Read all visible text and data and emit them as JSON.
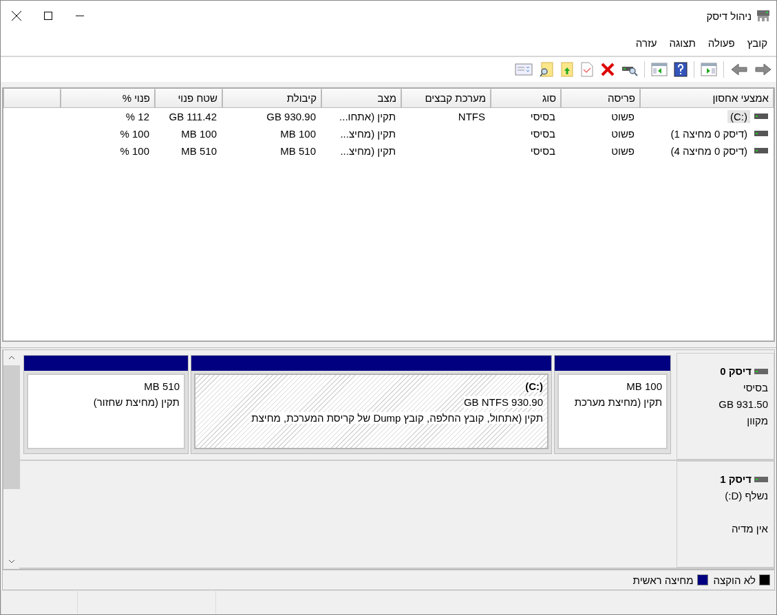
{
  "window": {
    "title": "ניהול דיסק"
  },
  "menu": [
    "קובץ",
    "פעולה",
    "תצוגה",
    "עזרה"
  ],
  "table": {
    "columns": [
      "אמצעי אחסון",
      "פריסה",
      "סוג",
      "מערכת קבצים",
      "מצב",
      "קיבולת",
      "שטח פנוי",
      "פנוי %"
    ],
    "rows": [
      {
        "selected": true,
        "cells": [
          "(C:)",
          "פשוט",
          "בסיסי",
          "NTFS",
          "תקין (אתחו...",
          "930.90 GB",
          "111.42 GB",
          "12 %"
        ]
      },
      {
        "selected": false,
        "cells": [
          "(דיסק 0 מחיצה 1)",
          "פשוט",
          "בסיסי",
          "",
          "תקין (מחיצ...",
          "100 MB",
          "100 MB",
          "100 %"
        ]
      },
      {
        "selected": false,
        "cells": [
          "(דיסק 0 מחיצה 4)",
          "פשוט",
          "בסיסי",
          "",
          "תקין (מחיצ...",
          "510 MB",
          "510 MB",
          "100 %"
        ]
      }
    ]
  },
  "disks": [
    {
      "name": "דיסק 0",
      "type": "בסיסי",
      "size": "931.50 GB",
      "status": "מקוון",
      "partitions": [
        {
          "kind": "primary",
          "selected": false,
          "lines": [
            "100 MB",
            "תקין (מחיצת מערכת"
          ]
        },
        {
          "kind": "primary",
          "selected": true,
          "title": "(C:)",
          "lines": [
            "930.90 GB NTFS",
            "תקין (אתחול, קובץ החלפה, קובץ Dump של קריסת המערכת, מחיצת"
          ]
        },
        {
          "kind": "primary",
          "selected": false,
          "lines": [
            "510 MB",
            "תקין (מחיצת שחזור)"
          ]
        }
      ]
    },
    {
      "name": "דיסק 1",
      "type": "נשלף (D:)",
      "status": "אין מדיה"
    }
  ],
  "legend": [
    {
      "label": "לא הוקצה",
      "color": "#000000"
    },
    {
      "label": "מחיצה ראשית",
      "color": "#000080"
    }
  ]
}
